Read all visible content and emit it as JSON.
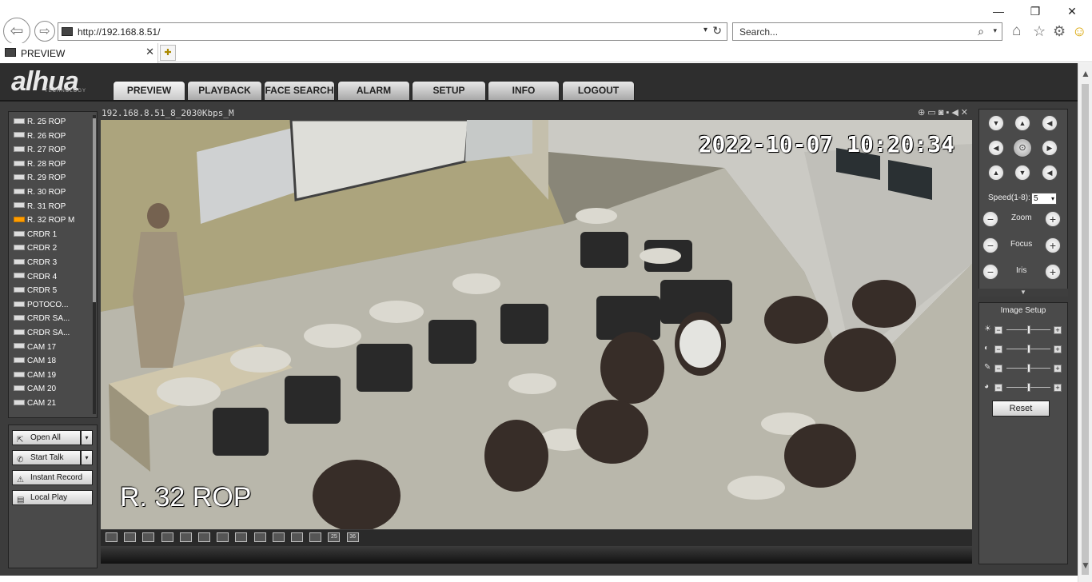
{
  "browser": {
    "url": "http://192.168.8.51/",
    "search_placeholder": "Search...",
    "tab_title": "PREVIEW",
    "back": "⇦",
    "forward": "⇨",
    "minimize": "—",
    "restore": "❐",
    "close": "✕",
    "icons": [
      "home-icon",
      "star-icon",
      "gear-icon",
      "smiley-icon"
    ]
  },
  "app": {
    "logo": "alhua",
    "logo_sub": "TECHNOLOGY",
    "nav": [
      "PREVIEW",
      "PLAYBACK",
      "FACE SEARCH",
      "ALARM",
      "SETUP",
      "INFO",
      "LOGOUT"
    ],
    "active_nav": "PREVIEW"
  },
  "cameras": [
    {
      "label": "R. 25 ROP"
    },
    {
      "label": "R. 26 ROP"
    },
    {
      "label": "R. 27 ROP"
    },
    {
      "label": "R. 28 ROP"
    },
    {
      "label": "R. 29 ROP"
    },
    {
      "label": "R. 30 ROP"
    },
    {
      "label": "R. 31 ROP"
    },
    {
      "label": "R. 32 ROP   M",
      "active": true
    },
    {
      "label": "CRDR 1"
    },
    {
      "label": "CRDR 2"
    },
    {
      "label": "CRDR 3"
    },
    {
      "label": "CRDR 4"
    },
    {
      "label": "CRDR 5"
    },
    {
      "label": "POTOCO..."
    },
    {
      "label": "CRDR SA..."
    },
    {
      "label": "CRDR SA..."
    },
    {
      "label": "CAM 17"
    },
    {
      "label": "CAM 18"
    },
    {
      "label": "CAM 19"
    },
    {
      "label": "CAM 20"
    },
    {
      "label": "CAM 21"
    }
  ],
  "actions": {
    "open_all": "Open All",
    "start_talk": "Start Talk",
    "instant_record": "Instant Record",
    "local_play": "Local Play"
  },
  "video": {
    "stream_title": "192.168.8.51_8_2030Kbps_M",
    "timestamp": "2022-10-07 10:20:34",
    "camera_overlay": "R. 32 ROP"
  },
  "layouts": [
    "",
    "",
    "",
    "",
    "",
    "",
    "",
    "",
    "",
    "",
    "",
    "",
    "25",
    "36"
  ],
  "ptz": {
    "speed_label": "Speed(1-8):",
    "speed_value": "5",
    "zoom_label": "Zoom",
    "focus_label": "Focus",
    "iris_label": "Iris"
  },
  "image_setup": {
    "title": "Image Setup",
    "brightness": 0.5,
    "contrast": 0.5,
    "saturation": 0.5,
    "hue": 0.5,
    "reset_label": "Reset"
  }
}
